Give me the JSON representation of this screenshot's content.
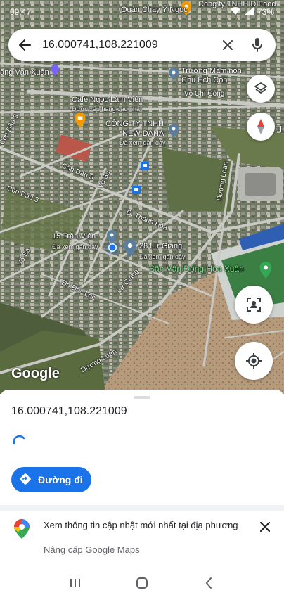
{
  "status_bar": {
    "time": "09:47",
    "battery": "73%"
  },
  "search": {
    "query": "16.000741,108.221009",
    "icons": [
      "back-arrow-icon",
      "close-icon",
      "microphone-icon"
    ]
  },
  "map": {
    "places": {
      "quan_chay": "Quán Chay Ý Ngọc",
      "cong_ty_top": "Công ty TNHH D Food",
      "truong_mam_non_1": "Trường Mầm non",
      "truong_mam_non_2": "Chú Ếch Con",
      "cafe": "Cafe Ngọc Lâm Viên",
      "cafe_sub": "Được xếp hạng cao nhất",
      "cong_ty_1": "CÔNG TY TNHH",
      "cong_ty_2": "NEW DANA",
      "cong_ty_sub": "Đã xem gần đây",
      "tran_vien": "15 Trần Viên",
      "tran_vien_sub": "Đã xem gần đây",
      "lu_giang": "28 Lư Giang",
      "lu_giang_sub": "Đã xem gần đây",
      "stadium": "Sân Vận Động Hòa Xuân",
      "van_xuan": "ăng Vạn Xuân",
      "ti_edge": "Ti"
    },
    "roads": {
      "vo_chi_cong": "Võ Chí Công",
      "con_dau_9": "Cồn Dầu 9",
      "con_dau_8": "Cồn Dầu 8",
      "con_dau_3": "Cồn Dầu 3",
      "vo_sa_1": "Võ Sa",
      "vo_sa_2": "Võ Sa",
      "duong_loan_1": "Dương Loan",
      "duong_loan_2": "Dương Loan",
      "thanh_hoa": "Đ. Thanh Hóa",
      "lu_giang": "Lư Giang",
      "do_doc_loc": "Đỗ Đốc Lộc"
    },
    "google_logo": "Google",
    "buttons": [
      "layers-icon",
      "compass-icon",
      "street-view-icon",
      "my-location-icon"
    ]
  },
  "sheet": {
    "coords": "16.000741,108.221009",
    "directions_label": "Đường đi"
  },
  "banner": {
    "title": "Xem thông tin cập nhật mới nhất tại địa phương",
    "subtitle": "Nâng cấp Google Maps"
  },
  "colors": {
    "accent": "#1a73e8",
    "stadium_green": "#34a853",
    "text": "#202124",
    "muted": "#5f6368"
  }
}
